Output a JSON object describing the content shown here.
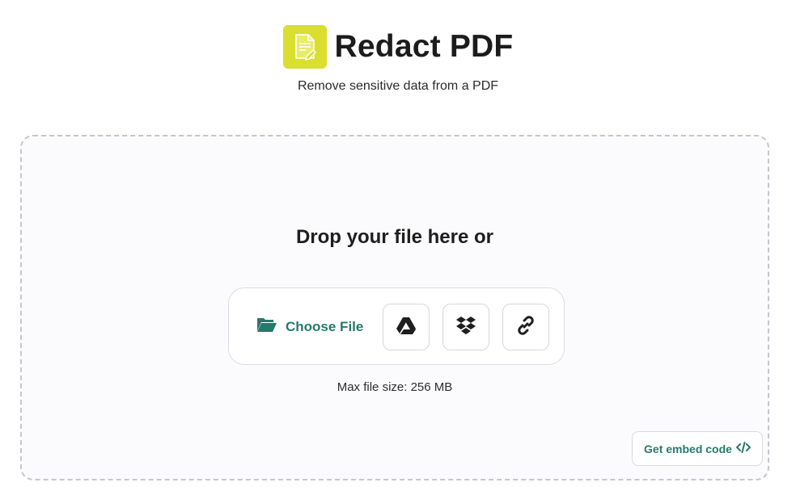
{
  "header": {
    "title": "Redact PDF",
    "subtitle": "Remove sensitive data from a PDF",
    "logo_icon": "redact-document-icon",
    "logo_color": "#d9de2f"
  },
  "dropzone": {
    "prompt": "Drop your file here or",
    "choose_file_label": "Choose File",
    "sources": [
      {
        "name": "google-drive",
        "icon": "google-drive-icon"
      },
      {
        "name": "dropbox",
        "icon": "dropbox-icon"
      },
      {
        "name": "url",
        "icon": "link-icon"
      }
    ],
    "max_size": "Max file size: 256 MB",
    "embed_label": "Get embed code"
  },
  "colors": {
    "accent": "#257a6c",
    "dashed_border": "#c4c7cc"
  }
}
